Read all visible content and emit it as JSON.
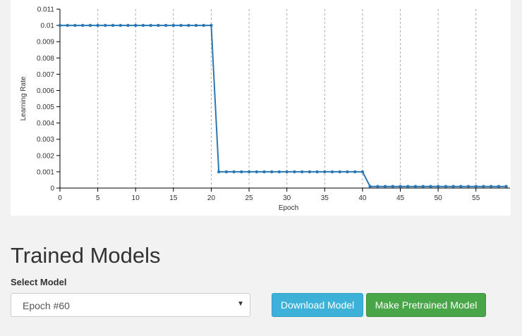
{
  "chart_data": {
    "type": "line",
    "title": "",
    "xlabel": "Epoch",
    "ylabel": "Learning Rate",
    "xlim": [
      0,
      59.5
    ],
    "ylim": [
      0,
      0.011
    ],
    "x_ticks": [
      "0",
      "5",
      "10",
      "15",
      "20",
      "25",
      "30",
      "35",
      "40",
      "45",
      "50",
      "55"
    ],
    "y_ticks": [
      "0",
      "0.001",
      "0.002",
      "0.003",
      "0.004",
      "0.005",
      "0.006",
      "0.007",
      "0.008",
      "0.009",
      "0.01",
      "0.011"
    ],
    "grid": "vertical dashed",
    "series": [
      {
        "color": "#2a77b4",
        "x": [
          0,
          1,
          2,
          3,
          4,
          5,
          6,
          7,
          8,
          9,
          10,
          11,
          12,
          13,
          14,
          15,
          16,
          17,
          18,
          19,
          20,
          21,
          22,
          23,
          24,
          25,
          26,
          27,
          28,
          29,
          30,
          31,
          32,
          33,
          34,
          35,
          36,
          37,
          38,
          39,
          40,
          41,
          42,
          43,
          44,
          45,
          46,
          47,
          48,
          49,
          50,
          51,
          52,
          53,
          54,
          55,
          56,
          57,
          58,
          59
        ],
        "values": [
          0.01,
          0.01,
          0.01,
          0.01,
          0.01,
          0.01,
          0.01,
          0.01,
          0.01,
          0.01,
          0.01,
          0.01,
          0.01,
          0.01,
          0.01,
          0.01,
          0.01,
          0.01,
          0.01,
          0.01,
          0.01,
          0.001,
          0.001,
          0.001,
          0.001,
          0.001,
          0.001,
          0.001,
          0.001,
          0.001,
          0.001,
          0.001,
          0.001,
          0.001,
          0.001,
          0.001,
          0.001,
          0.001,
          0.001,
          0.001,
          0.001,
          0.0001,
          0.0001,
          0.0001,
          0.0001,
          0.0001,
          0.0001,
          0.0001,
          0.0001,
          0.0001,
          0.0001,
          0.0001,
          0.0001,
          0.0001,
          0.0001,
          0.0001,
          0.0001,
          0.0001,
          0.0001,
          0.0001
        ]
      }
    ]
  },
  "trained_models": {
    "title": "Trained Models",
    "select_label": "Select Model",
    "selected_model": "Epoch #60",
    "caret_icon": "chevron-down-icon",
    "download_label": "Download Model",
    "pretrained_label": "Make Pretrained Model",
    "colors": {
      "download": "#3eb1d8",
      "pretrained": "#48a548",
      "series": "#2a77b4"
    }
  }
}
